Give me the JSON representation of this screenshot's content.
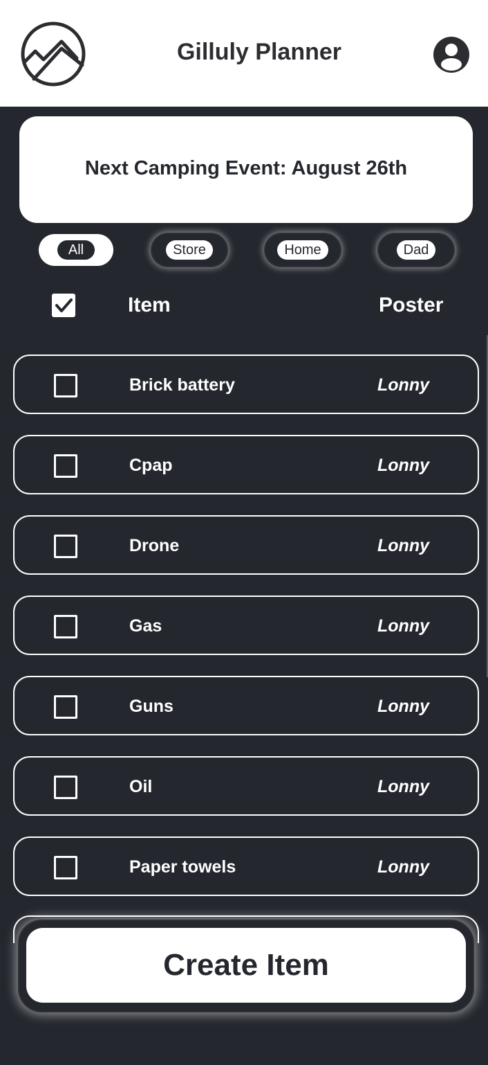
{
  "header": {
    "title": "Gilluly Planner",
    "logo_icon": "mountain-logo-icon",
    "avatar_icon": "user-avatar-icon"
  },
  "event": {
    "text": "Next Camping Event: August 26th"
  },
  "filters": [
    {
      "label": "All",
      "active": true
    },
    {
      "label": "Store",
      "active": false
    },
    {
      "label": "Home",
      "active": false
    },
    {
      "label": "Dad",
      "active": false
    }
  ],
  "list_header": {
    "select_all_checked": true,
    "item_label": "Item",
    "poster_label": "Poster"
  },
  "items": [
    {
      "name": "Brick battery",
      "poster": "Lonny",
      "checked": false
    },
    {
      "name": "Cpap",
      "poster": "Lonny",
      "checked": false
    },
    {
      "name": "Drone",
      "poster": "Lonny",
      "checked": false
    },
    {
      "name": "Gas",
      "poster": "Lonny",
      "checked": false
    },
    {
      "name": "Guns",
      "poster": "Lonny",
      "checked": false
    },
    {
      "name": "Oil",
      "poster": "Lonny",
      "checked": false
    },
    {
      "name": "Paper towels",
      "poster": "Lonny",
      "checked": false
    }
  ],
  "create_button": {
    "label": "Create Item"
  },
  "colors": {
    "background": "#24272e",
    "surface": "#ffffff",
    "text_dark": "#2b2d31"
  }
}
